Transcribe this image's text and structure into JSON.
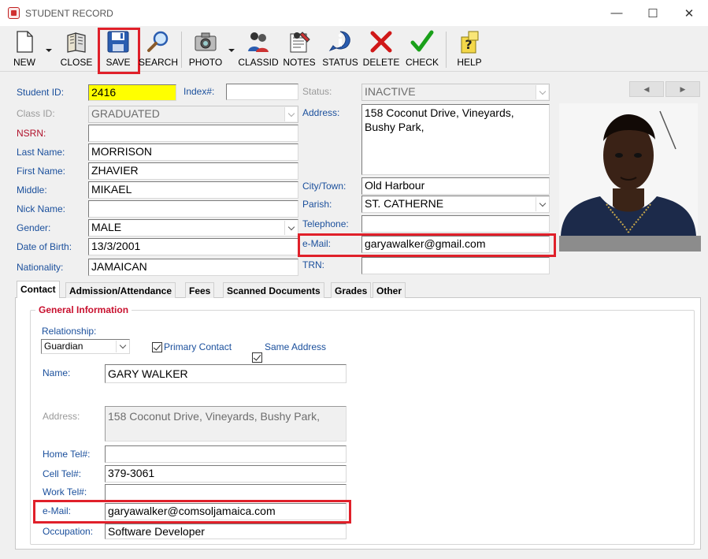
{
  "window": {
    "title": "STUDENT RECORD",
    "minimize": "—",
    "maximize": "☐",
    "close": "✕"
  },
  "toolbar": {
    "new": "NEW",
    "close": "CLOSE",
    "save": "SAVE",
    "search": "SEARCH",
    "photo": "PHOTO",
    "classid": "CLASSID",
    "notes": "NOTES",
    "status": "STATUS",
    "delete": "DELETE",
    "check": "CHECK",
    "help": "HELP"
  },
  "labels": {
    "student_id": "Student ID:",
    "index": "Index#:",
    "class_id": "Class ID:",
    "nsrn": "NSRN:",
    "last_name": "Last Name:",
    "first_name": "First Name:",
    "middle": "Middle:",
    "nick_name": "Nick Name:",
    "gender": "Gender:",
    "dob": "Date of Birth:",
    "nationality": "Nationality:",
    "status": "Status:",
    "address": "Address:",
    "city": "City/Town:",
    "parish": "Parish:",
    "telephone": "Telephone:",
    "email": "e-Mail:",
    "trn": "TRN:"
  },
  "student": {
    "student_id": "2416",
    "index": "",
    "class_id": "GRADUATED",
    "nsrn": "",
    "last_name": "MORRISON",
    "first_name": "ZHAVIER",
    "middle": "MIKAEL",
    "nick_name": "",
    "gender": "MALE",
    "dob": "13/3/2001",
    "nationality": "JAMAICAN",
    "status": "INACTIVE",
    "address": "158 Coconut Drive, Vineyards,\nBushy Park,",
    "city": "Old Harbour",
    "parish": "ST. CATHERNE",
    "telephone": "",
    "email": "garyawalker@gmail.com",
    "trn": ""
  },
  "nav": {
    "prev": "◀",
    "next": "▶"
  },
  "tabs": [
    "Contact",
    "Admission/Attendance",
    "Fees",
    "Scanned Documents",
    "Grades",
    "Other"
  ],
  "contact": {
    "group_title": "General Information",
    "relationship_label": "Relationship:",
    "relationship": "Guardian",
    "primary_contact": "Primary Contact",
    "same_address": "Same Address",
    "name_label": "Name:",
    "name": "GARY WALKER",
    "address_label": "Address:",
    "address": "158 Coconut Drive, Vineyards, Bushy Park,",
    "home_tel_label": "Home Tel#:",
    "home_tel": "",
    "cell_tel_label": "Cell Tel#:",
    "cell_tel": "379-3061",
    "work_tel_label": "Work Tel#:",
    "work_tel": "",
    "email_label": "e-Mail:",
    "email": "garyawalker@comsoljamaica.com",
    "occupation_label": "Occupation:",
    "occupation": "Software Developer"
  },
  "colors": {
    "highlight": "#e0202a",
    "label_blue": "#1a4f9c",
    "label_red": "#b0102a",
    "id_field": "#ffff00"
  }
}
